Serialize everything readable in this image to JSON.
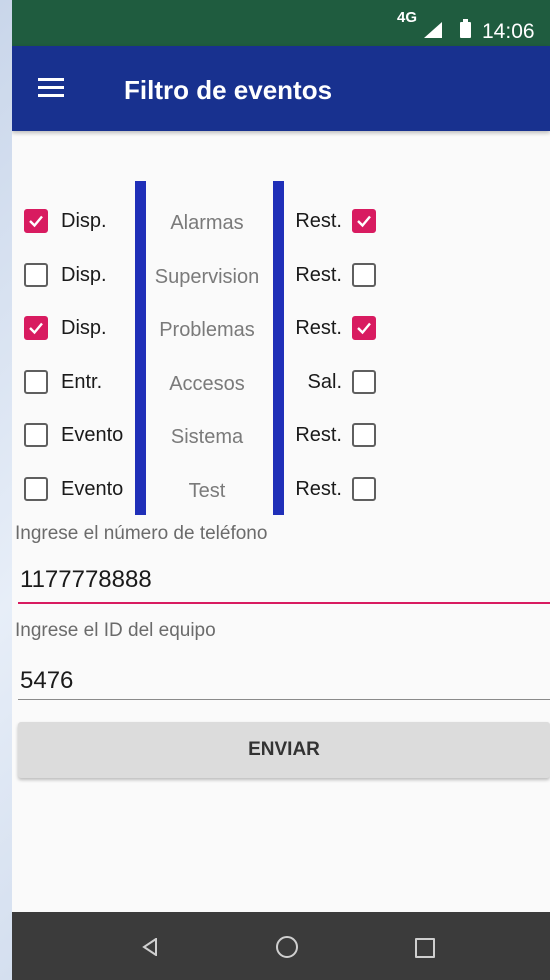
{
  "status_bar": {
    "network": "4G",
    "time": "14:06"
  },
  "app_bar": {
    "title": "Filtro de eventos"
  },
  "filters": [
    {
      "left_label": "Disp.",
      "left_checked": true,
      "category": "Alarmas",
      "right_label": "Rest.",
      "right_checked": true
    },
    {
      "left_label": "Disp.",
      "left_checked": false,
      "category": "Supervision",
      "right_label": "Rest.",
      "right_checked": false
    },
    {
      "left_label": "Disp.",
      "left_checked": true,
      "category": "Problemas",
      "right_label": "Rest.",
      "right_checked": true
    },
    {
      "left_label": "Entr.",
      "left_checked": false,
      "category": "Accesos",
      "right_label": "Sal.",
      "right_checked": false
    },
    {
      "left_label": "Evento",
      "left_checked": false,
      "category": "Sistema",
      "right_label": "Rest.",
      "right_checked": false
    },
    {
      "left_label": "Evento",
      "left_checked": false,
      "category": "Test",
      "right_label": "Rest.",
      "right_checked": false
    }
  ],
  "phone_field": {
    "label": "Ingrese el número de teléfono",
    "value": "1177778888"
  },
  "device_field": {
    "label": "Ingrese el ID del equipo",
    "value": "5476"
  },
  "send_button": {
    "label": "ENVIAR"
  },
  "colors": {
    "accent": "#d81b60",
    "app_bar": "#18318f",
    "status_bar": "#1f5c3f",
    "divider": "#1f2fb8"
  },
  "icons": {
    "menu": "hamburger-icon",
    "back": "back-triangle-icon",
    "home": "home-circle-icon",
    "recents": "recents-square-icon"
  }
}
